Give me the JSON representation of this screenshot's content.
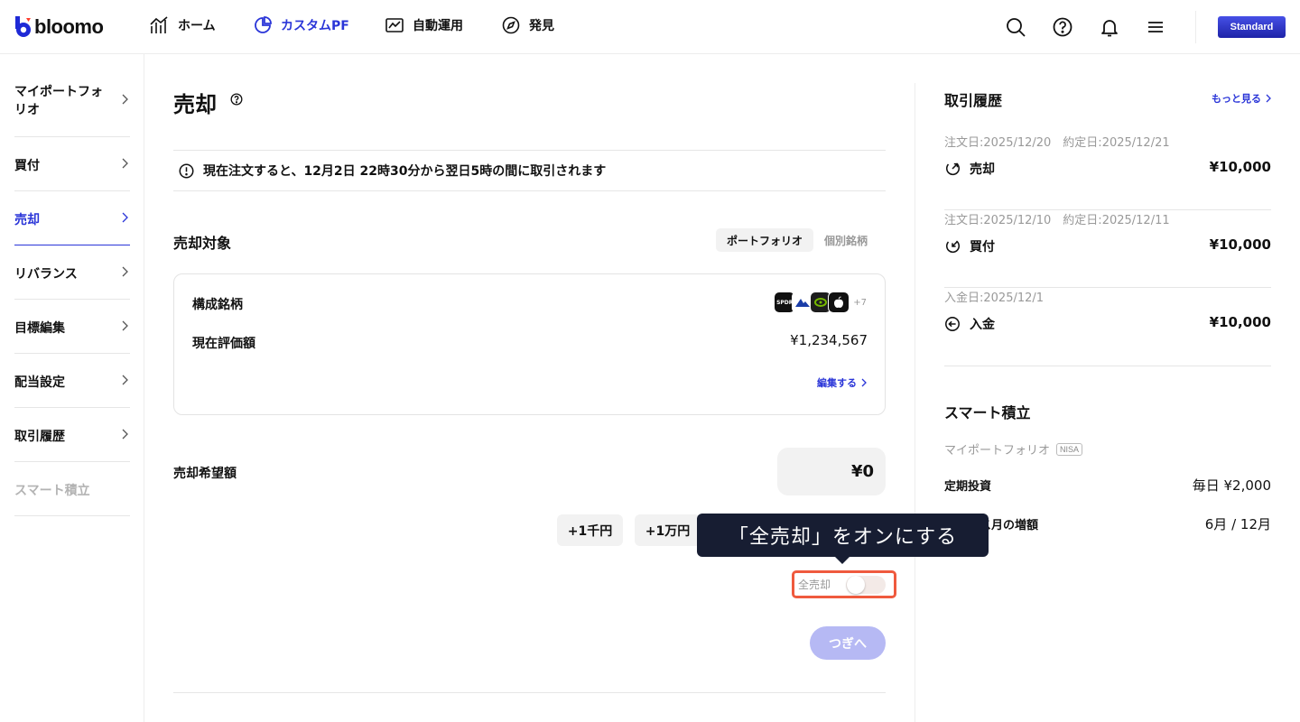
{
  "header": {
    "brand": "bloomo",
    "nav": [
      {
        "label": "ホーム",
        "icon": "chart-bar-icon",
        "active": false
      },
      {
        "label": "カスタムPF",
        "icon": "pie-chart-icon",
        "active": true
      },
      {
        "label": "自動運用",
        "icon": "line-chart-icon",
        "active": false
      },
      {
        "label": "発見",
        "icon": "compass-icon",
        "active": false
      }
    ],
    "icons": [
      "search-icon",
      "help-icon",
      "bell-icon",
      "menu-icon"
    ],
    "plan": "Standard"
  },
  "sidebar": {
    "items": [
      {
        "label": "マイポートフォリオ",
        "state": "normal"
      },
      {
        "label": "買付",
        "state": "normal"
      },
      {
        "label": "売却",
        "state": "active"
      },
      {
        "label": "リバランス",
        "state": "normal"
      },
      {
        "label": "目標編集",
        "state": "normal"
      },
      {
        "label": "配当設定",
        "state": "normal"
      },
      {
        "label": "取引履歴",
        "state": "normal"
      },
      {
        "label": "スマート積立",
        "state": "disabled"
      }
    ]
  },
  "main": {
    "title": "売却",
    "notice": "現在注文すると、12月2日 22時30分から翌日5時の間に取引されます",
    "target": {
      "title": "売却対象",
      "segments": [
        "ポートフォリオ",
        "個別銘柄"
      ],
      "selected_segment": "ポートフォリオ"
    },
    "card": {
      "holdings_label": "構成銘柄",
      "tickers": [
        "SPDR",
        "",
        "",
        ""
      ],
      "more": "+7",
      "value_label": "現在評価額",
      "value": "¥1,234,567",
      "edit": "編集する"
    },
    "amount": {
      "label": "売却希望額",
      "value": "¥0",
      "chips": [
        "+1千円",
        "+1万円"
      ]
    },
    "sell_all": {
      "label": "全売却",
      "on": false
    },
    "next": "つぎへ",
    "tooltip": "「全売却」をオンにする"
  },
  "right": {
    "history": {
      "title": "取引履歴",
      "more": "もっと見る",
      "items": [
        {
          "date": "注文日:2025/12/20　約定日:2025/12/21",
          "type": "売却",
          "amount": "¥10,000",
          "icon": "sell-icon"
        },
        {
          "date": "注文日:2025/12/10　約定日:2025/12/11",
          "type": "買付",
          "amount": "¥10,000",
          "icon": "buy-icon"
        },
        {
          "date": "入金日:2025/12/1",
          "type": "入金",
          "amount": "¥10,000",
          "icon": "deposit-icon"
        }
      ]
    },
    "smart": {
      "title": "スマート積立",
      "portfolio": "マイポートフォリオ",
      "badge": "NISA",
      "rows": [
        {
          "k": "定期投資",
          "v": "毎日 ¥2,000"
        },
        {
          "k": "ボーナス月の増額",
          "v": "6月 / 12月"
        }
      ]
    }
  },
  "colors": {
    "accent": "#2a35d8",
    "highlight": "#ef5a3e",
    "tooltip": "#171d32",
    "button_disabled": "#b6b9f4"
  }
}
